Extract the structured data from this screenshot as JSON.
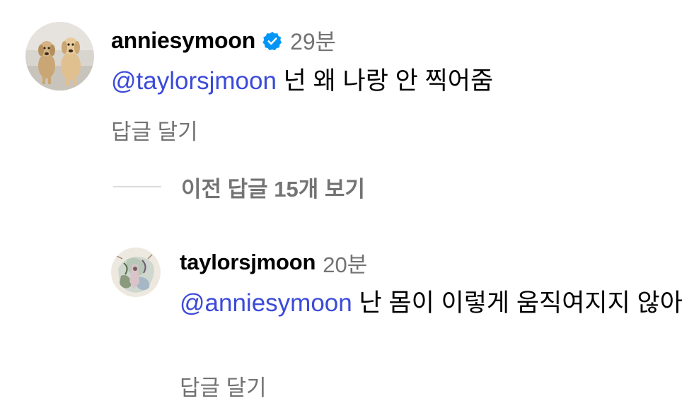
{
  "comments": [
    {
      "username": "anniesymoon",
      "verified": true,
      "time": "29분",
      "mention": "@taylorsjmoon",
      "text": " 넌 왜 나랑 안 찍어줌",
      "reply_label": "답글 달기",
      "avatar_icon": "two-dogs-avatar"
    },
    {
      "username": "taylorsjmoon",
      "verified": false,
      "time": "20분",
      "mention": "@anniesymoon",
      "text": " 난 몸이 이렇게 움직여지지 않아",
      "reply_label": "답글 달기",
      "avatar_icon": "illustration-avatar"
    }
  ],
  "view_replies": {
    "label": "이전 답글 15개 보기"
  },
  "colors": {
    "mention": "#3b4ad9",
    "verified_badge": "#0095f6",
    "secondary_text": "#737373"
  }
}
